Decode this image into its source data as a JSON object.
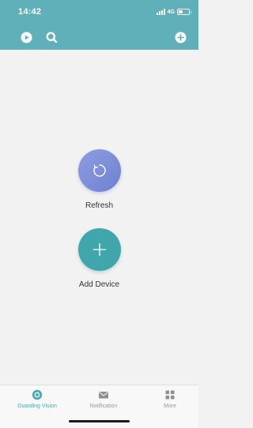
{
  "status_bar": {
    "time": "14:42",
    "network": "4G"
  },
  "toolbar": {
    "icons": [
      "play-icon",
      "search-icon",
      "add-icon"
    ]
  },
  "main": {
    "refresh_label": "Refresh",
    "add_device_label": "Add Device"
  },
  "tabs": [
    {
      "label": "Guarding Vision",
      "icon": "camera-icon",
      "active": true
    },
    {
      "label": "Notification",
      "icon": "mail-icon",
      "active": false
    },
    {
      "label": "More",
      "icon": "grid-icon",
      "active": false
    }
  ],
  "colors": {
    "header": "#5fb0b9",
    "refresh_button": "#7b8ad6",
    "add_button": "#41a6ac",
    "active_tab": "#4aa8b5"
  }
}
